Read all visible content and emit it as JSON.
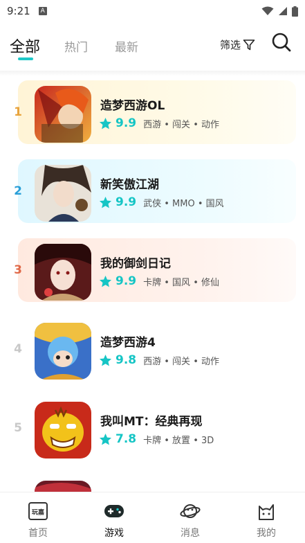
{
  "status": {
    "time": "9:21",
    "app_icon_letter": "A"
  },
  "tabs": [
    {
      "label": "全部",
      "active": true
    },
    {
      "label": "热门",
      "active": false
    },
    {
      "label": "最新",
      "active": false
    }
  ],
  "filter_label": "筛选",
  "games": [
    {
      "rank": "1",
      "title": "造梦西游OL",
      "score": "9.9",
      "tags": "西游 • 闯关 • 动作",
      "rank_color": "#e8a33c",
      "bg": "#fff7df"
    },
    {
      "rank": "2",
      "title": "新笑傲江湖",
      "score": "9.9",
      "tags": "武侠 • MMO • 国风",
      "rank_color": "#2a9fd8",
      "bg": "#e6fbff"
    },
    {
      "rank": "3",
      "title": "我的御剑日记",
      "score": "9.9",
      "tags": "卡牌 • 国风 • 修仙",
      "rank_color": "#e06a4a",
      "bg": "#fff0ea"
    },
    {
      "rank": "4",
      "title": "造梦西游4",
      "score": "9.8",
      "tags": "西游 • 闯关 • 动作",
      "rank_color": "#c8c8c8",
      "bg": ""
    },
    {
      "rank": "5",
      "title": "我叫MT：经典再现",
      "score": "7.8",
      "tags": "卡牌 • 放置 • 3D",
      "rank_color": "#c8c8c8",
      "bg": ""
    }
  ],
  "colors": {
    "accent": "#16c5c5"
  },
  "bottom_nav": [
    {
      "label": "首页",
      "icon": "home-logo-icon",
      "active": false
    },
    {
      "label": "游戏",
      "icon": "gamepad-icon",
      "active": true
    },
    {
      "label": "消息",
      "icon": "planet-icon",
      "active": false
    },
    {
      "label": "我的",
      "icon": "cat-face-icon",
      "active": false
    }
  ],
  "home_icon_text": "玩嘉"
}
